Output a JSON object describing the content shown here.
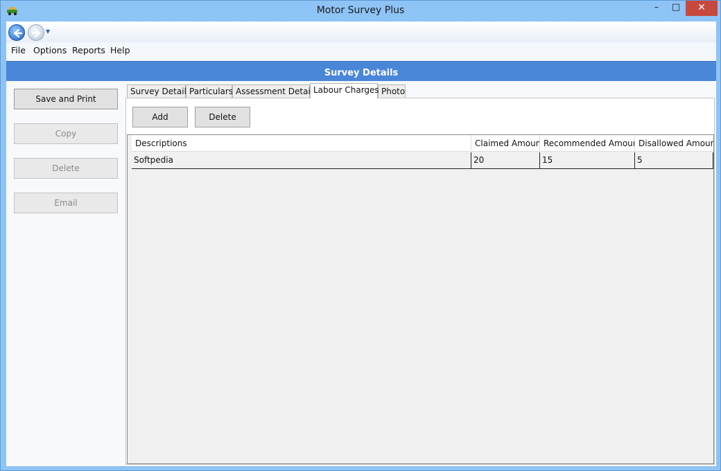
{
  "window": {
    "title": "Motor Survey Plus",
    "minimize_glyph": "–",
    "maximize_glyph": "□",
    "close_glyph": "✕"
  },
  "menu": {
    "items": [
      "File",
      "Options",
      "Reports",
      "Help"
    ]
  },
  "header": {
    "title": "Survey Details"
  },
  "sidebar": {
    "buttons": [
      {
        "label": "Save and Print",
        "enabled": true
      },
      {
        "label": "Copy",
        "enabled": false
      },
      {
        "label": "Delete",
        "enabled": false
      },
      {
        "label": "Email",
        "enabled": false
      }
    ]
  },
  "tabs": {
    "items": [
      "Survey Details",
      "Particulars",
      "Assessment Details",
      "Labour Charges",
      "Photo"
    ],
    "active": "Labour Charges"
  },
  "panel": {
    "add_label": "Add",
    "delete_label": "Delete"
  },
  "grid": {
    "columns": [
      "Descriptions",
      "Claimed Amount",
      "Recommended Amount",
      "Disallowed Amount"
    ],
    "rows": [
      [
        "Softpedia",
        "20",
        "15",
        "5"
      ]
    ]
  },
  "colors": {
    "header_band": "#4a86d8",
    "window_frame": "#8ec3f5",
    "close_button": "#c7483d"
  },
  "icons": {
    "app": "car-icon",
    "back": "back-arrow-icon",
    "forward": "forward-arrow-icon"
  }
}
